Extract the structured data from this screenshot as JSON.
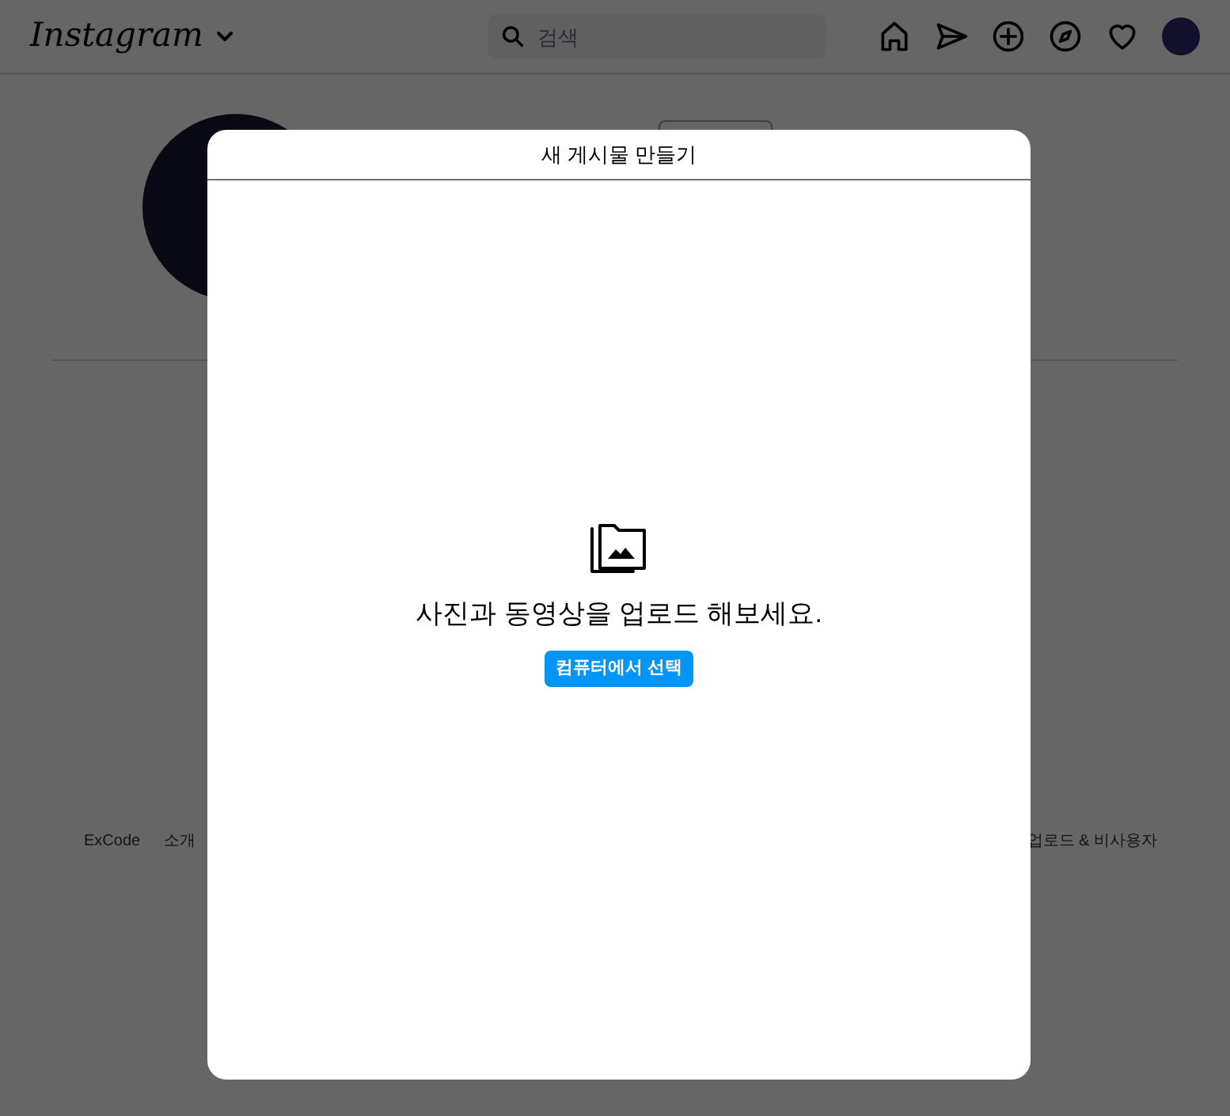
{
  "header": {
    "logo": "Instagram",
    "search": {
      "placeholder": "검색"
    }
  },
  "footer_links": [
    "ExCode",
    "소개",
    "업로드 & 비사용자"
  ],
  "modal": {
    "title": "새 게시물 만들기",
    "message": "사진과 동영상을 업로드 해보세요.",
    "button": "컴퓨터에서 선택"
  }
}
